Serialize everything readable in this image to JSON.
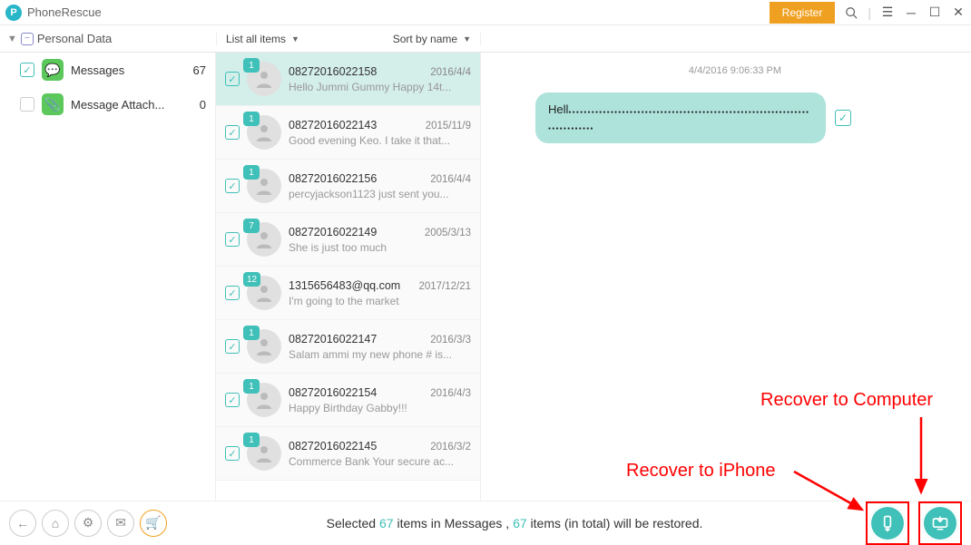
{
  "app": {
    "title": "PhoneRescue",
    "register": "Register"
  },
  "sidebar": {
    "header": "Personal Data",
    "items": [
      {
        "label": "Messages",
        "count": "67",
        "checked": true,
        "icon": "msg"
      },
      {
        "label": "Message Attach...",
        "count": "0",
        "checked": false,
        "icon": "att"
      }
    ]
  },
  "listHeader": {
    "left": "List all items",
    "right": "Sort by name"
  },
  "messages": [
    {
      "badge": "1",
      "number": "08272016022158",
      "date": "2016/4/4",
      "preview": "Hello Jummi Gummy Happy 14t...",
      "selected": true
    },
    {
      "badge": "1",
      "number": "08272016022143",
      "date": "2015/11/9",
      "preview": "Good evening Keo. I take it that..."
    },
    {
      "badge": "1",
      "number": "08272016022156",
      "date": "2016/4/4",
      "preview": "percyjackson1123 just sent you..."
    },
    {
      "badge": "7",
      "number": "08272016022149",
      "date": "2005/3/13",
      "preview": "She is just too much"
    },
    {
      "badge": "12",
      "number": "1315656483@qq.com",
      "date": "2017/12/21",
      "preview": "I'm going to the market"
    },
    {
      "badge": "1",
      "number": "08272016022147",
      "date": "2016/3/3",
      "preview": "Salam ammi my new phone # is..."
    },
    {
      "badge": "1",
      "number": "08272016022154",
      "date": "2016/4/3",
      "preview": "Happy Birthday Gabby!!!"
    },
    {
      "badge": "1",
      "number": "08272016022145",
      "date": "2016/3/2",
      "preview": "Commerce Bank Your secure ac..."
    }
  ],
  "detail": {
    "timestamp": "4/4/2016 9:06:33 PM",
    "bubblePrefix": "Hell"
  },
  "footer": {
    "s1": "Selected ",
    "n1": "67",
    "s2": " items in Messages , ",
    "n2": "67",
    "s3": " items (in total) will be restored."
  },
  "annotations": {
    "iphone": "Recover to iPhone",
    "computer": "Recover to Computer"
  }
}
